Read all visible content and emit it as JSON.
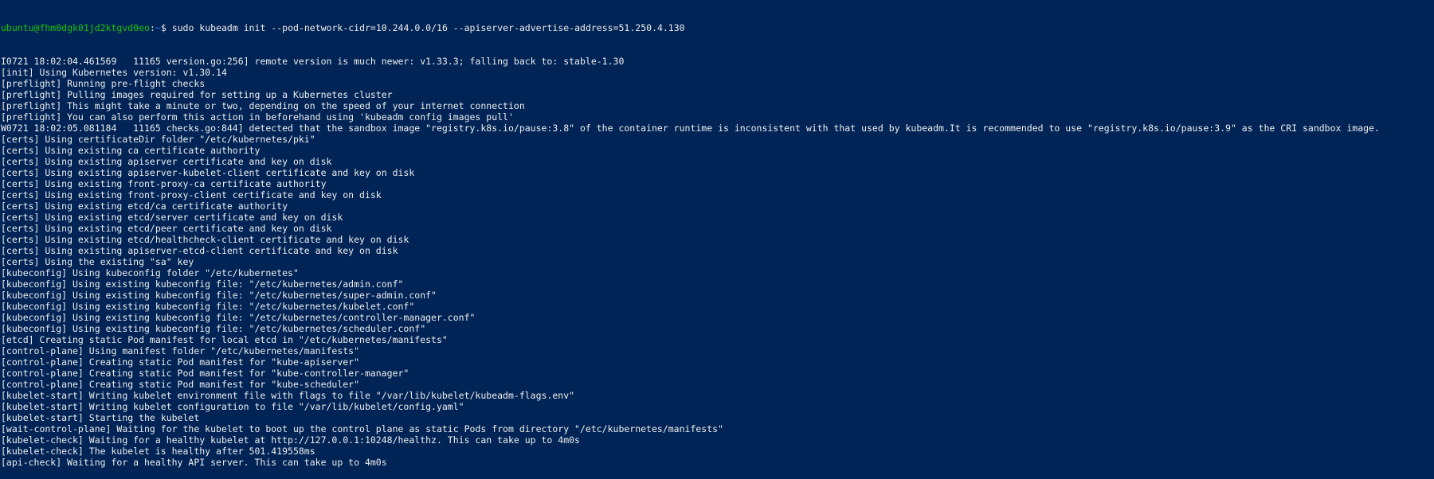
{
  "terminal": {
    "prompt": {
      "user_host": "ubuntu@fhm0dgk01jd2ktgvd0eo",
      "colon": ":",
      "cwd": "~",
      "symbol": "$",
      "command": "sudo kubeadm init --pod-network-cidr=10.244.0.0/16 --apiserver-advertise-address=51.250.4.130"
    },
    "lines": [
      "I0721 18:02:04.461569   11165 version.go:256] remote version is much newer: v1.33.3; falling back to: stable-1.30",
      "[init] Using Kubernetes version: v1.30.14",
      "[preflight] Running pre-flight checks",
      "[preflight] Pulling images required for setting up a Kubernetes cluster",
      "[preflight] This might take a minute or two, depending on the speed of your internet connection",
      "[preflight] You can also perform this action in beforehand using 'kubeadm config images pull'",
      "W0721 18:02:05.081184   11165 checks.go:844] detected that the sandbox image \"registry.k8s.io/pause:3.8\" of the container runtime is inconsistent with that used by kubeadm.It is recommended to use \"registry.k8s.io/pause:3.9\" as the CRI sandbox image.",
      "[certs] Using certificateDir folder \"/etc/kubernetes/pki\"",
      "[certs] Using existing ca certificate authority",
      "[certs] Using existing apiserver certificate and key on disk",
      "[certs] Using existing apiserver-kubelet-client certificate and key on disk",
      "[certs] Using existing front-proxy-ca certificate authority",
      "[certs] Using existing front-proxy-client certificate and key on disk",
      "[certs] Using existing etcd/ca certificate authority",
      "[certs] Using existing etcd/server certificate and key on disk",
      "[certs] Using existing etcd/peer certificate and key on disk",
      "[certs] Using existing etcd/healthcheck-client certificate and key on disk",
      "[certs] Using existing apiserver-etcd-client certificate and key on disk",
      "[certs] Using the existing \"sa\" key",
      "[kubeconfig] Using kubeconfig folder \"/etc/kubernetes\"",
      "[kubeconfig] Using existing kubeconfig file: \"/etc/kubernetes/admin.conf\"",
      "[kubeconfig] Using existing kubeconfig file: \"/etc/kubernetes/super-admin.conf\"",
      "[kubeconfig] Using existing kubeconfig file: \"/etc/kubernetes/kubelet.conf\"",
      "[kubeconfig] Using existing kubeconfig file: \"/etc/kubernetes/controller-manager.conf\"",
      "[kubeconfig] Using existing kubeconfig file: \"/etc/kubernetes/scheduler.conf\"",
      "[etcd] Creating static Pod manifest for local etcd in \"/etc/kubernetes/manifests\"",
      "[control-plane] Using manifest folder \"/etc/kubernetes/manifests\"",
      "[control-plane] Creating static Pod manifest for \"kube-apiserver\"",
      "[control-plane] Creating static Pod manifest for \"kube-controller-manager\"",
      "[control-plane] Creating static Pod manifest for \"kube-scheduler\"",
      "[kubelet-start] Writing kubelet environment file with flags to file \"/var/lib/kubelet/kubeadm-flags.env\"",
      "[kubelet-start] Writing kubelet configuration to file \"/var/lib/kubelet/config.yaml\"",
      "[kubelet-start] Starting the kubelet",
      "[wait-control-plane] Waiting for the kubelet to boot up the control plane as static Pods from directory \"/etc/kubernetes/manifests\"",
      "[kubelet-check] Waiting for a healthy kubelet at http://127.0.0.1:10248/healthz. This can take up to 4m0s",
      "[kubelet-check] The kubelet is healthy after 501.419558ms",
      "[api-check] Waiting for a healthy API server. This can take up to 4m0s"
    ],
    "colors": {
      "background": "#012456",
      "foreground": "#eeeeee",
      "user_host": "#16c60c",
      "cwd": "#3b78ff"
    }
  }
}
